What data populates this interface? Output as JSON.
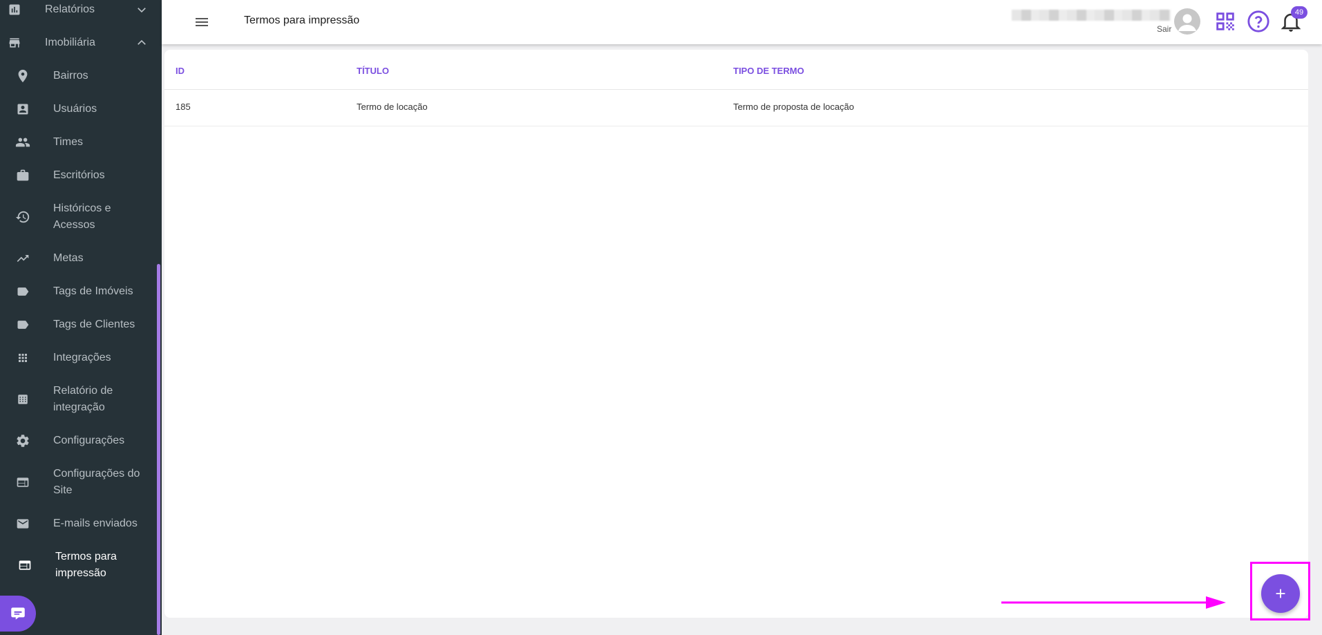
{
  "sidebar": {
    "items": [
      {
        "label": "Relatórios",
        "icon": "bar-chart-icon"
      },
      {
        "label": "Imobiliária",
        "icon": "store-icon"
      },
      {
        "label": "Bairros",
        "icon": "location-pin-icon"
      },
      {
        "label": "Usuários",
        "icon": "contact-card-icon"
      },
      {
        "label": "Times",
        "icon": "people-icon"
      },
      {
        "label": "Escritórios",
        "icon": "briefcase-icon"
      },
      {
        "label": "Históricos e Acessos",
        "icon": "history-icon"
      },
      {
        "label": "Metas",
        "icon": "trending-up-icon"
      },
      {
        "label": "Tags de Imóveis",
        "icon": "tag-icon"
      },
      {
        "label": "Tags de Clientes",
        "icon": "tag-icon"
      },
      {
        "label": "Integrações",
        "icon": "apps-grid-icon"
      },
      {
        "label": "Relatório de integração",
        "icon": "calendar-grid-icon"
      },
      {
        "label": "Configurações",
        "icon": "gear-icon"
      },
      {
        "label": "Configurações do Site",
        "icon": "web-window-icon"
      },
      {
        "label": "E-mails enviados",
        "icon": "mail-icon"
      },
      {
        "label": "Termos para impressão",
        "icon": "web-window-icon"
      }
    ]
  },
  "header": {
    "title": "Termos para impressão",
    "logout_label": "Sair",
    "notification_count": "49"
  },
  "table": {
    "columns": [
      "ID",
      "TÍTULO",
      "TIPO DE TERMO"
    ],
    "rows": [
      {
        "id": "185",
        "title": "Termo de locação",
        "type": "Termo de proposta de locação"
      }
    ]
  },
  "colors": {
    "accent": "#7b4fe0",
    "sidebar_bg": "#263238",
    "annotation": "#ff00ff"
  }
}
